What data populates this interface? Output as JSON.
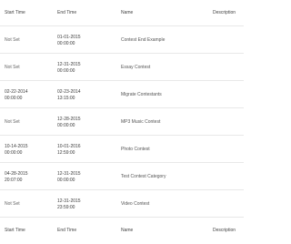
{
  "columns": {
    "start": "Start Time",
    "end": "End Time",
    "name": "Name",
    "description": "Description"
  },
  "rows": [
    {
      "start": "Not Set",
      "end": [
        "01-01-2015",
        "00:00:00"
      ],
      "name": "Contest End Example"
    },
    {
      "start": "Not Set",
      "end": [
        "12-31-2015",
        "00:00:00"
      ],
      "name": "Essay Contest"
    },
    {
      "start": [
        "02-22-2014",
        "00:00:00"
      ],
      "end": [
        "02-23-2014",
        "13:15:00"
      ],
      "name": "Migrate Contestants"
    },
    {
      "start": "Not Set",
      "end": [
        "12-28-2015",
        "00:00:00"
      ],
      "name": "MP3 Music Contest"
    },
    {
      "start": [
        "10-14-2015",
        "00:00:00"
      ],
      "end": [
        "10-01-2016",
        "12:59:00"
      ],
      "name": "Photo Contest"
    },
    {
      "start": [
        "04-28-2015",
        "20:07:00"
      ],
      "end": [
        "12-31-2015",
        "00:00:00"
      ],
      "name": "Test Contest Category"
    },
    {
      "start": "Not Set",
      "end": [
        "12-31-2015",
        "23:59:00"
      ],
      "name": "Video Contest"
    }
  ]
}
